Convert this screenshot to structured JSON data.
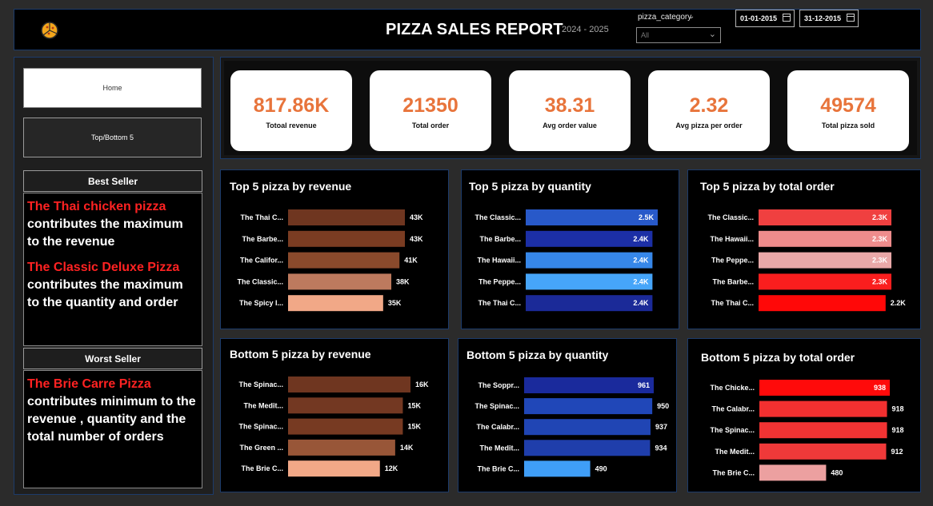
{
  "header": {
    "title": "PIZZA SALES REPORT",
    "subtitle": "2024 - 2025",
    "slicer_label": "pizza_category",
    "slicer_value": "All",
    "date_from": "01-01-2015",
    "date_to": "31-12-2015"
  },
  "nav": {
    "home": "Home",
    "top_bottom": "Top/Bottom 5"
  },
  "best_seller": {
    "heading": "Best Seller",
    "line1_red": "The Thai chicken pizza",
    "line1_text": "contributes the maximum to the revenue",
    "line2_red": "The Classic Deluxe Pizza",
    "line2_text": "contributes the maximum to the quantity and order"
  },
  "worst_seller": {
    "heading": "Worst Seller",
    "line_red": "The Brie Carre Pizza",
    "line_text": "contributes minimum to the revenue , quantity and the total number of orders"
  },
  "kpis": [
    {
      "value": "817.86K",
      "label": "Totoal revenue"
    },
    {
      "value": "21350",
      "label": "Total order"
    },
    {
      "value": "38.31",
      "label": "Avg order value"
    },
    {
      "value": "2.32",
      "label": "Avg pizza per order"
    },
    {
      "value": "49574",
      "label": "Total pizza sold"
    }
  ],
  "chart_data": [
    {
      "type": "bar",
      "title": "Top 5 pizza by revenue",
      "categories": [
        "The Thai C...",
        "The Barbe...",
        "The Califor...",
        "The Classic...",
        "The Spicy I..."
      ],
      "values": [
        43,
        43,
        41,
        38,
        35
      ],
      "labels": [
        "43K",
        "43K",
        "41K",
        "38K",
        "35K"
      ],
      "colors": [
        "#6f3620",
        "#7a3c22",
        "#8a4a2c",
        "#bd7a5e",
        "#f1a887"
      ],
      "label_inside": false
    },
    {
      "type": "bar",
      "title": "Top 5 pizza by quantity",
      "categories": [
        "The Classic...",
        "The Barbe...",
        "The Hawaii...",
        "The Peppe...",
        "The Thai C..."
      ],
      "values": [
        2.5,
        2.4,
        2.4,
        2.4,
        2.4
      ],
      "labels": [
        "2.5K",
        "2.4K",
        "2.4K",
        "2.4K",
        "2.4K"
      ],
      "colors": [
        "#2859c9",
        "#1c2fa6",
        "#3687e9",
        "#46a5f9",
        "#1b2a98"
      ],
      "label_inside": true
    },
    {
      "type": "bar",
      "title": "Top 5 pizza by total order",
      "categories": [
        "The Classic...",
        "The Hawaii...",
        "The Peppe...",
        "The Barbe...",
        "The Thai C..."
      ],
      "values": [
        2.3,
        2.3,
        2.3,
        2.3,
        2.2
      ],
      "labels": [
        "2.3K",
        "2.3K",
        "2.3K",
        "2.3K",
        "2.2K"
      ],
      "colors": [
        "#f04040",
        "#ee8c8c",
        "#e9a8a8",
        "#fa1e1e",
        "#ff0808"
      ],
      "label_inside_count": 4
    },
    {
      "type": "bar",
      "title": "Bottom 5 pizza by revenue",
      "categories": [
        "The Spinac...",
        "The Medit...",
        "The Spinac...",
        "The Green ...",
        "The Brie C..."
      ],
      "values": [
        16,
        15,
        15,
        14,
        12
      ],
      "labels": [
        "16K",
        "15K",
        "15K",
        "14K",
        "12K"
      ],
      "colors": [
        "#6f3620",
        "#733822",
        "#773a22",
        "#985638",
        "#f1a887"
      ],
      "label_inside": false
    },
    {
      "type": "bar",
      "title": "Bottom 5 pizza by quantity",
      "categories": [
        "The Soppr...",
        "The Spinac...",
        "The Calabr...",
        "The Medit...",
        "The Brie C..."
      ],
      "values": [
        961,
        950,
        937,
        934,
        490
      ],
      "labels": [
        "961",
        "950",
        "937",
        "934",
        "490"
      ],
      "colors": [
        "#1a2a9c",
        "#2047b8",
        "#2045b4",
        "#1f3eab",
        "#3f9ef7"
      ],
      "label_inside_count": 1
    },
    {
      "type": "bar",
      "title": "Bottom 5 pizza by total order",
      "categories": [
        "The Chicke...",
        "The Calabr...",
        "The Spinac...",
        "The Medit...",
        "The Brie C..."
      ],
      "values": [
        938,
        918,
        918,
        912,
        480
      ],
      "labels": [
        "938",
        "918",
        "918",
        "912",
        "480"
      ],
      "colors": [
        "#ff0a0a",
        "#f23030",
        "#f13333",
        "#ef3939",
        "#eca0a0"
      ],
      "label_inside_count": 1
    }
  ]
}
